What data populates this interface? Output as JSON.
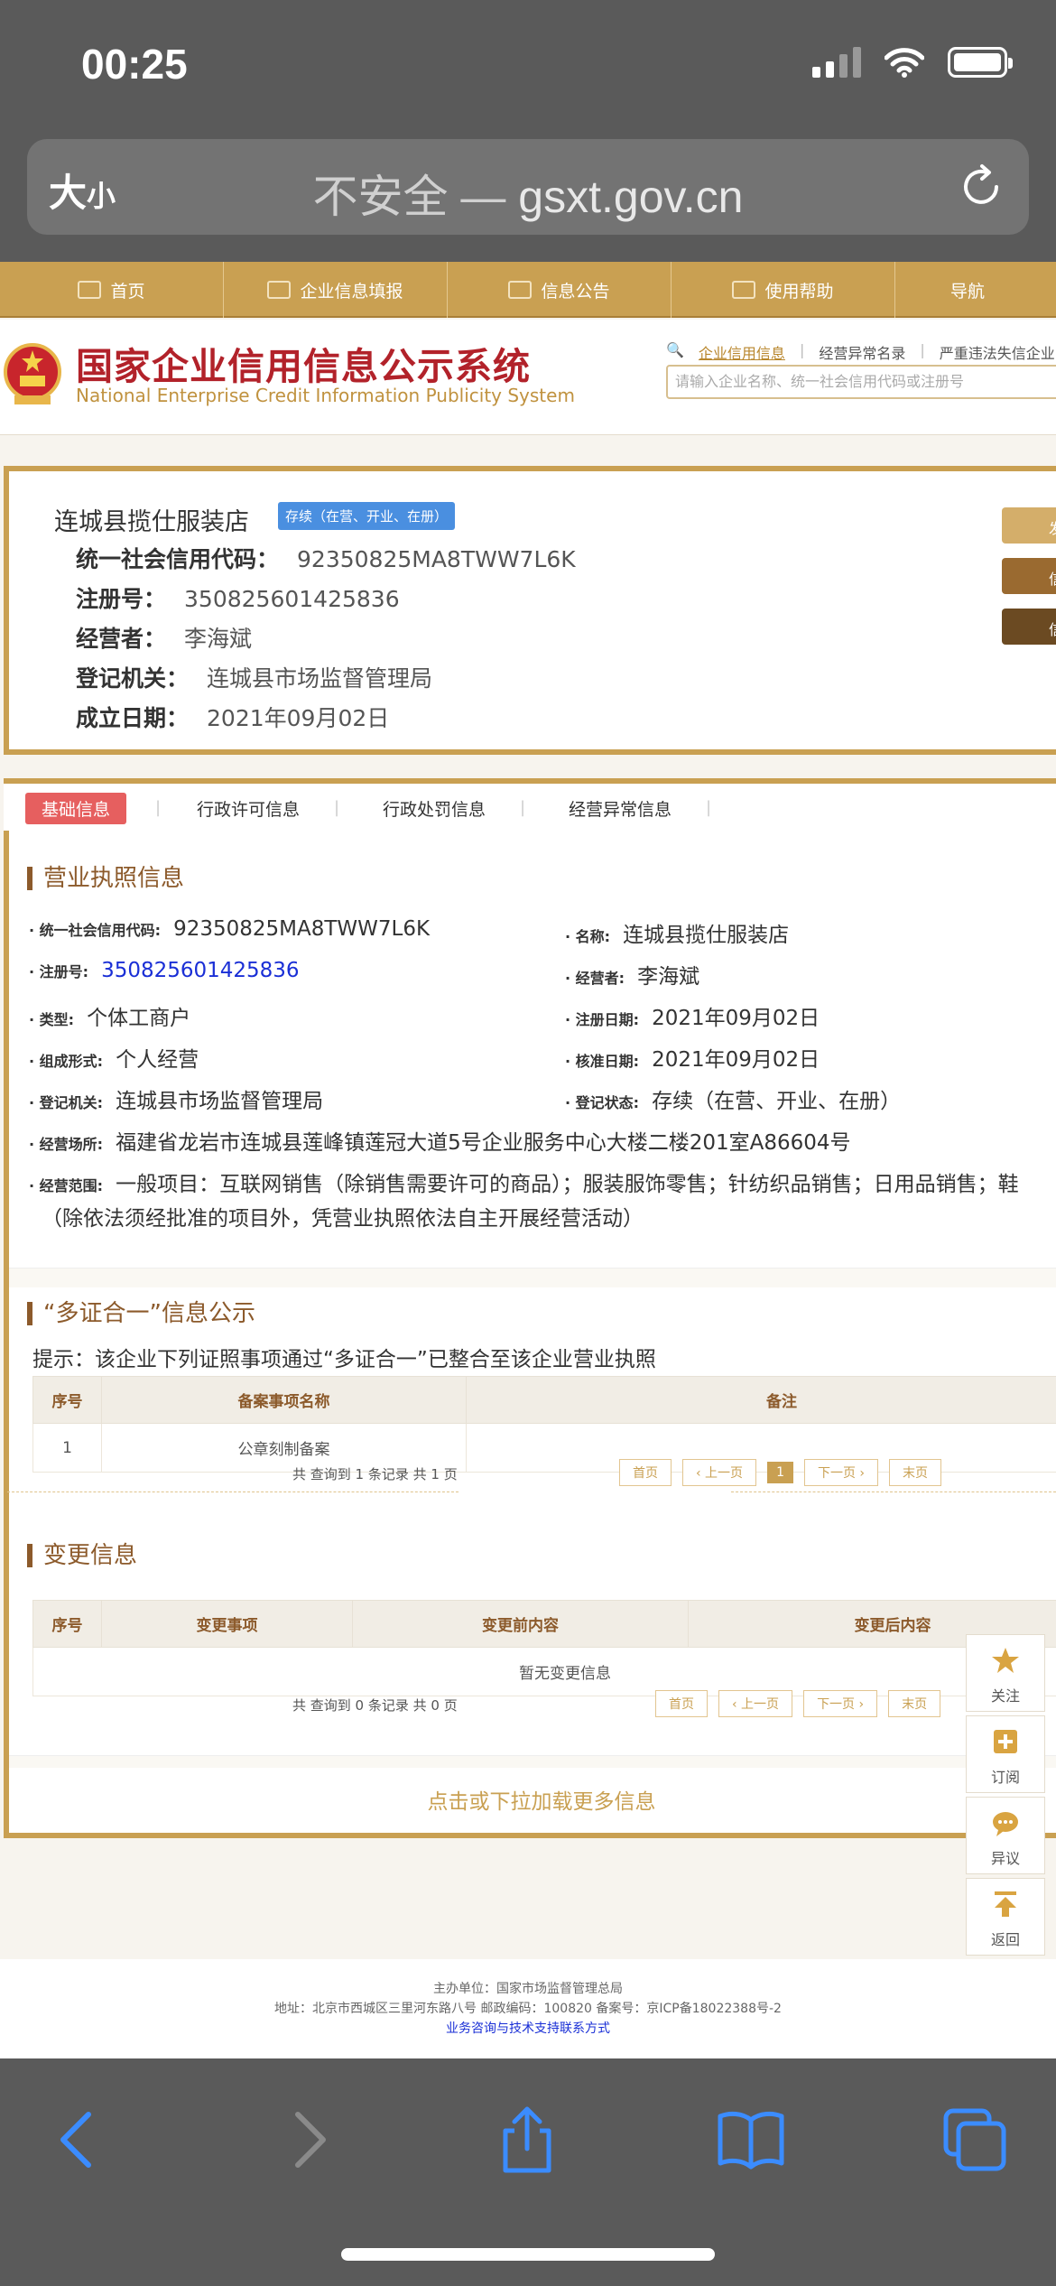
{
  "status_bar": {
    "time": "00:25"
  },
  "browser": {
    "text_size_label_big": "大",
    "text_size_label_small": "小",
    "insecure_label": "不安全 —",
    "domain": "gsxt.gov.cn"
  },
  "topnav": [
    {
      "label": "首页",
      "icon": "home-icon"
    },
    {
      "label": "企业信息填报",
      "icon": "edit-icon"
    },
    {
      "label": "信息公告",
      "icon": "document-icon"
    },
    {
      "label": "使用帮助",
      "icon": "megaphone-icon"
    },
    {
      "label": "导航",
      "icon": ""
    }
  ],
  "header": {
    "title_cn": "国家企业信用信息公示系统",
    "title_en": "National Enterprise Credit Information Publicity System",
    "search_tabs": [
      "企业信用信息",
      "经营异常名录",
      "严重违法失信企业"
    ],
    "search_placeholder": "请输入企业名称、统一社会信用代码或注册号"
  },
  "enterprise": {
    "name": "连城县揽仕服装店",
    "status_badge": "存续（在营、开业、在册）",
    "credit_code_label": "统一社会信用代码：",
    "credit_code": "92350825MA8TWW7L6K",
    "reg_no_label": "注册号：",
    "reg_no": "350825601425836",
    "operator_label": "经营者：",
    "operator": "李海斌",
    "authority_label": "登记机关：",
    "authority": "连城县市场监督管理局",
    "founded_label": "成立日期：",
    "founded": "2021年09月02日",
    "side_buttons": [
      "发",
      "信",
      "信"
    ]
  },
  "tabs": [
    "基础信息",
    "行政许可信息",
    "行政处罚信息",
    "经营异常信息"
  ],
  "license": {
    "section_title": "营业执照信息",
    "credit_code_label": "统一社会信用代码:",
    "credit_code": "92350825MA8TWW7L6K",
    "name_label": "名称:",
    "name": "连城县揽仕服装店",
    "reg_no_label": "注册号:",
    "reg_no": "350825601425836",
    "operator_label": "经营者:",
    "operator": "李海斌",
    "type_label": "类型:",
    "type": "个体工商户",
    "reg_date_label": "注册日期:",
    "reg_date": "2021年09月02日",
    "form_label": "组成形式:",
    "form": "个人经营",
    "approve_date_label": "核准日期:",
    "approve_date": "2021年09月02日",
    "authority_label": "登记机关:",
    "authority": "连城县市场监督管理局",
    "reg_status_label": "登记状态:",
    "reg_status": "存续（在营、开业、在册）",
    "address_label": "经营场所:",
    "address": "福建省龙岩市连城县莲峰镇莲冠大道5号企业服务中心大楼二楼201室A86604号",
    "scope_label": "经营范围:",
    "scope_line1": "一般项目：互联网销售（除销售需要许可的商品）；服装服饰零售；针纺织品销售；日用品销售；鞋",
    "scope_line2": "（除依法须经批准的项目外，凭营业执照依法自主开展经营活动）"
  },
  "multi_cert": {
    "section_title": "“多证合一”信息公示",
    "tip": "提示：该企业下列证照事项通过“多证合一”已整合至该企业营业执照",
    "columns": [
      "序号",
      "备案事项名称",
      "备注"
    ],
    "rows": [
      [
        "1",
        "公章刻制备案",
        ""
      ]
    ],
    "pager_info": "共 查询到 1 条记录 共 1 页",
    "pager": {
      "first": "首页",
      "prev": "‹ 上一页",
      "current": "1",
      "next": "下一页 ›",
      "last": "末页"
    }
  },
  "changes": {
    "section_title": "变更信息",
    "columns": [
      "序号",
      "变更事项",
      "变更前内容",
      "变更后内容"
    ],
    "empty": "暂无变更信息",
    "pager_info": "共 查询到 0 条记录 共 0 页",
    "pager": {
      "first": "首页",
      "prev": "‹ 上一页",
      "next": "下一页 ›",
      "last": "末页"
    }
  },
  "load_more": "点击或下拉加载更多信息",
  "float_buttons": [
    {
      "label": "关注",
      "icon": "star-icon"
    },
    {
      "label": "订阅",
      "icon": "plus-box-icon"
    },
    {
      "label": "异议",
      "icon": "chat-icon"
    },
    {
      "label": "返回",
      "icon": "arrow-up-icon"
    }
  ],
  "footer": {
    "line1": "主办单位：国家市场监督管理总局",
    "line2": "地址：北京市西城区三里河东路八号   邮政编码：100820   备案号：京ICP备18022388号-2",
    "line3": "业务咨询与技术支持联系方式"
  },
  "colors": {
    "accent": "#c9a052",
    "title_red": "#b2222a",
    "badge_blue": "#4a8fe0",
    "active_tab": "#e65f5f"
  }
}
